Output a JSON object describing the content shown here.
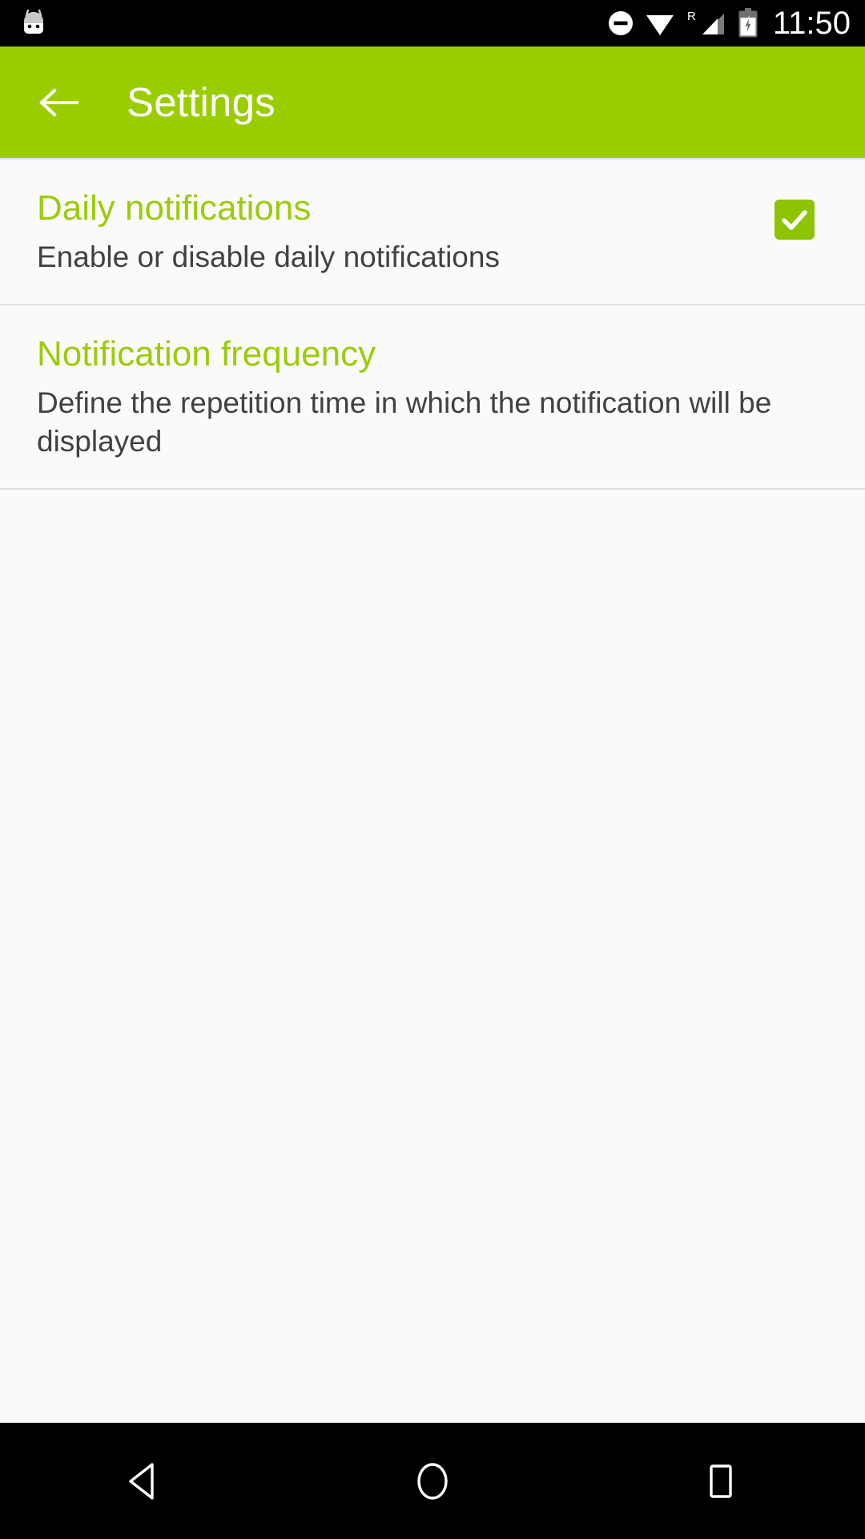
{
  "status_bar": {
    "app_icon": "marshmallow-egg-icon",
    "icons": [
      {
        "name": "do-not-disturb-icon",
        "label": "Do not disturb"
      },
      {
        "name": "wifi-icon",
        "label": "Wi-Fi"
      },
      {
        "name": "cellular-signal-roaming-icon",
        "label": "R"
      },
      {
        "name": "battery-charging-icon",
        "label": "Battery charging"
      }
    ],
    "roaming_indicator": "R",
    "time": "11:50",
    "background": "#000000",
    "foreground": "#ffffff"
  },
  "app_bar": {
    "back_icon": "arrow-left-icon",
    "title": "Settings",
    "background": "#9acd00",
    "title_color": "#ffffff"
  },
  "preferences": {
    "accent_color": "#9bcc0a",
    "summary_color": "#414141",
    "items": [
      {
        "key": "daily-notifications",
        "title": "Daily notifications",
        "summary": "Enable or disable daily notifications",
        "widget": "checkbox",
        "checked": true,
        "checkbox_color": "#8cc400",
        "check_mark": "check-icon"
      },
      {
        "key": "notification-frequency",
        "title": "Notification frequency",
        "summary": "Define the repetition time in which the notification will be displayed",
        "widget": "none",
        "checked": null
      }
    ]
  },
  "nav_bar": {
    "background": "#000000",
    "buttons": [
      {
        "name": "nav-back-button",
        "icon": "triangle-left-icon",
        "label": "Back"
      },
      {
        "name": "nav-home-button",
        "icon": "circle-icon",
        "label": "Home"
      },
      {
        "name": "nav-recents-button",
        "icon": "square-icon",
        "label": "Recent apps"
      }
    ]
  }
}
